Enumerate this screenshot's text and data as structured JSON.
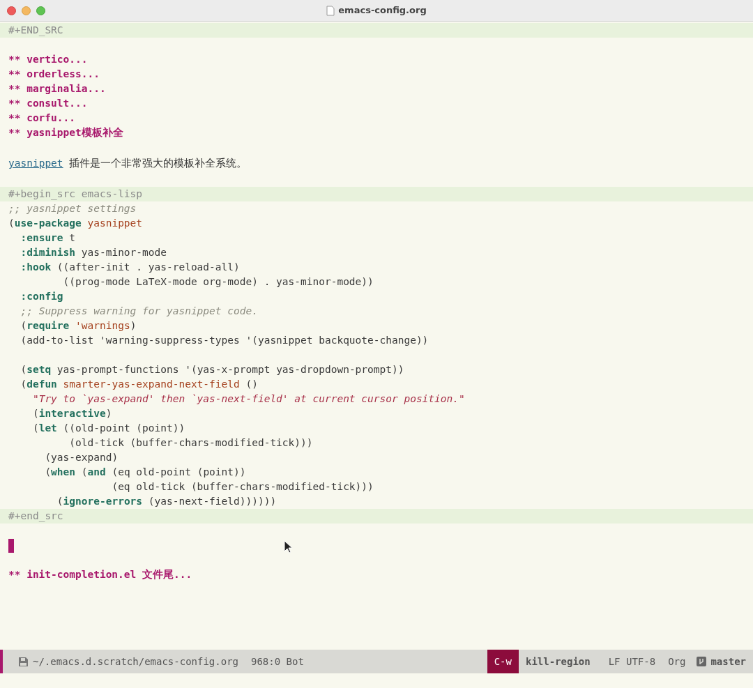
{
  "window": {
    "title": "emacs-config.org"
  },
  "buffer": {
    "lines": [
      {
        "kind": "delimiter",
        "text": "#+END_SRC"
      },
      {
        "kind": "blank"
      },
      {
        "kind": "heading",
        "marker": "**",
        "text": "vertico..."
      },
      {
        "kind": "heading",
        "marker": "**",
        "text": "orderless..."
      },
      {
        "kind": "heading",
        "marker": "**",
        "text": "marginalia..."
      },
      {
        "kind": "heading",
        "marker": "**",
        "text": "consult..."
      },
      {
        "kind": "heading",
        "marker": "**",
        "text": "corfu..."
      },
      {
        "kind": "heading",
        "marker": "**",
        "text": "yasnippet模板补全"
      },
      {
        "kind": "blank"
      },
      {
        "kind": "paragraph",
        "link": "yasnippet",
        "text": "插件是一个非常强大的模板补全系统。"
      },
      {
        "kind": "blank"
      },
      {
        "kind": "delimiter",
        "text": "#+begin_src emacs-lisp"
      },
      {
        "kind": "code",
        "tokens": [
          {
            "kind": "comment",
            "text": ";; yasnippet settings"
          }
        ]
      },
      {
        "kind": "code",
        "tokens": [
          {
            "kind": "plain",
            "text": "("
          },
          {
            "kind": "keyword",
            "text": "use-package"
          },
          {
            "kind": "name",
            "text": " yasnippet"
          }
        ]
      },
      {
        "kind": "code",
        "tokens": [
          {
            "kind": "keyword",
            "text": "  :ensure"
          },
          {
            "kind": "plain",
            "text": " t"
          }
        ]
      },
      {
        "kind": "code",
        "tokens": [
          {
            "kind": "keyword",
            "text": "  :diminish"
          },
          {
            "kind": "plain",
            "text": " yas-minor-mode"
          }
        ]
      },
      {
        "kind": "code",
        "tokens": [
          {
            "kind": "keyword",
            "text": "  :hook"
          },
          {
            "kind": "plain",
            "text": " ((after-init . yas-reload-all)"
          }
        ]
      },
      {
        "kind": "code",
        "tokens": [
          {
            "kind": "plain",
            "text": "         ((prog-mode LaTeX-mode org-mode) . yas-minor-mode))"
          }
        ]
      },
      {
        "kind": "code",
        "tokens": [
          {
            "kind": "keyword",
            "text": "  :config"
          }
        ]
      },
      {
        "kind": "code",
        "tokens": [
          {
            "kind": "comment",
            "text": "  ;; Suppress warning for yasnippet code."
          }
        ]
      },
      {
        "kind": "code",
        "tokens": [
          {
            "kind": "plain",
            "text": "  ("
          },
          {
            "kind": "keyword",
            "text": "require"
          },
          {
            "kind": "quote",
            "text": " 'warnings"
          },
          {
            "kind": "plain",
            "text": ")"
          }
        ]
      },
      {
        "kind": "code",
        "tokens": [
          {
            "kind": "plain",
            "text": "  (add-to-list 'warning-suppress-types '(yasnippet backquote-change))"
          }
        ]
      },
      {
        "kind": "blank"
      },
      {
        "kind": "code",
        "tokens": [
          {
            "kind": "plain",
            "text": "  ("
          },
          {
            "kind": "keyword",
            "text": "setq"
          },
          {
            "kind": "plain",
            "text": " yas-prompt-functions '(yas-x-prompt yas-dropdown-prompt))"
          }
        ]
      },
      {
        "kind": "code",
        "tokens": [
          {
            "kind": "plain",
            "text": "  ("
          },
          {
            "kind": "keyword",
            "text": "defun"
          },
          {
            "kind": "name",
            "text": " smarter-yas-expand-next-field"
          },
          {
            "kind": "plain",
            "text": " ()"
          }
        ]
      },
      {
        "kind": "code",
        "tokens": [
          {
            "kind": "string",
            "text": "    \"Try to `yas-expand' then `yas-next-field' at current cursor position.\""
          }
        ]
      },
      {
        "kind": "code",
        "tokens": [
          {
            "kind": "plain",
            "text": "    ("
          },
          {
            "kind": "keyword",
            "text": "interactive"
          },
          {
            "kind": "plain",
            "text": ")"
          }
        ]
      },
      {
        "kind": "code",
        "tokens": [
          {
            "kind": "plain",
            "text": "    ("
          },
          {
            "kind": "keyword",
            "text": "let"
          },
          {
            "kind": "plain",
            "text": " ((old-point (point))"
          }
        ]
      },
      {
        "kind": "code",
        "tokens": [
          {
            "kind": "plain",
            "text": "          (old-tick (buffer-chars-modified-tick)))"
          }
        ]
      },
      {
        "kind": "code",
        "tokens": [
          {
            "kind": "plain",
            "text": "      (yas-expand)"
          }
        ]
      },
      {
        "kind": "code",
        "tokens": [
          {
            "kind": "plain",
            "text": "      ("
          },
          {
            "kind": "keyword",
            "text": "when"
          },
          {
            "kind": "plain",
            "text": " ("
          },
          {
            "kind": "keyword",
            "text": "and"
          },
          {
            "kind": "plain",
            "text": " (eq old-point (point))"
          }
        ]
      },
      {
        "kind": "code",
        "tokens": [
          {
            "kind": "plain",
            "text": "                 (eq old-tick (buffer-chars-modified-tick)))"
          }
        ]
      },
      {
        "kind": "code",
        "tokens": [
          {
            "kind": "plain",
            "text": "        ("
          },
          {
            "kind": "keyword",
            "text": "ignore-errors"
          },
          {
            "kind": "plain",
            "text": " (yas-next-field))))))"
          }
        ]
      },
      {
        "kind": "delimiter",
        "text": "#+end_src"
      },
      {
        "kind": "blank"
      },
      {
        "kind": "cursor"
      },
      {
        "kind": "blank"
      },
      {
        "kind": "heading",
        "marker": "**",
        "text": "init-completion.el 文件尾..."
      }
    ]
  },
  "mode_line": {
    "file": "~/.emacs.d.scratch/emacs-config.org",
    "position": "968:0 Bot",
    "key": "C-w",
    "command": "kill-region",
    "encoding": "LF UTF-8",
    "mode": "Org",
    "branch": "master"
  }
}
